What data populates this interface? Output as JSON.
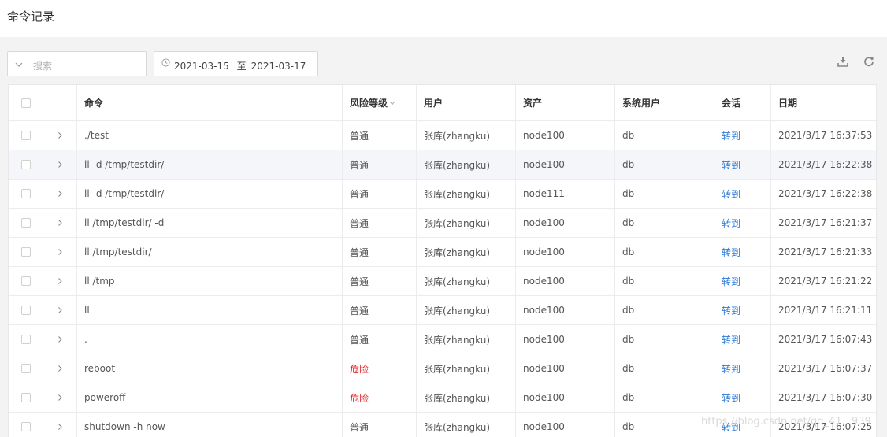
{
  "page": {
    "title": "命令记录"
  },
  "toolbar": {
    "search_placeholder": "搜索",
    "date_start": "2021-03-15",
    "date_sep": "至",
    "date_end": "2021-03-17"
  },
  "table": {
    "columns": [
      "命令",
      "风险等级",
      "用户",
      "资产",
      "系统用户",
      "会话",
      "日期"
    ],
    "rows": [
      {
        "command": "./test",
        "risk": "普通",
        "risk_level": "normal",
        "user": "张库(zhangku)",
        "asset": "node100",
        "sys_user": "db",
        "session": "转到",
        "date": "2021/3/17 16:37:53"
      },
      {
        "command": "ll -d /tmp/testdir/",
        "risk": "普通",
        "risk_level": "normal",
        "user": "张库(zhangku)",
        "asset": "node100",
        "sys_user": "db",
        "session": "转到",
        "date": "2021/3/17 16:22:38"
      },
      {
        "command": "ll -d /tmp/testdir/",
        "risk": "普通",
        "risk_level": "normal",
        "user": "张库(zhangku)",
        "asset": "node111",
        "sys_user": "db",
        "session": "转到",
        "date": "2021/3/17 16:22:38"
      },
      {
        "command": "ll /tmp/testdir/ -d",
        "risk": "普通",
        "risk_level": "normal",
        "user": "张库(zhangku)",
        "asset": "node100",
        "sys_user": "db",
        "session": "转到",
        "date": "2021/3/17 16:21:37"
      },
      {
        "command": "ll /tmp/testdir/",
        "risk": "普通",
        "risk_level": "normal",
        "user": "张库(zhangku)",
        "asset": "node100",
        "sys_user": "db",
        "session": "转到",
        "date": "2021/3/17 16:21:33"
      },
      {
        "command": "ll /tmp",
        "risk": "普通",
        "risk_level": "normal",
        "user": "张库(zhangku)",
        "asset": "node100",
        "sys_user": "db",
        "session": "转到",
        "date": "2021/3/17 16:21:22"
      },
      {
        "command": "ll",
        "risk": "普通",
        "risk_level": "normal",
        "user": "张库(zhangku)",
        "asset": "node100",
        "sys_user": "db",
        "session": "转到",
        "date": "2021/3/17 16:21:11"
      },
      {
        "command": ".",
        "risk": "普通",
        "risk_level": "normal",
        "user": "张库(zhangku)",
        "asset": "node100",
        "sys_user": "db",
        "session": "转到",
        "date": "2021/3/17 16:07:43"
      },
      {
        "command": "reboot",
        "risk": "危险",
        "risk_level": "danger",
        "user": "张库(zhangku)",
        "asset": "node100",
        "sys_user": "db",
        "session": "转到",
        "date": "2021/3/17 16:07:37"
      },
      {
        "command": "poweroff",
        "risk": "危险",
        "risk_level": "danger",
        "user": "张库(zhangku)",
        "asset": "node100",
        "sys_user": "db",
        "session": "转到",
        "date": "2021/3/17 16:07:30"
      },
      {
        "command": "shutdown -h now",
        "risk": "普通",
        "risk_level": "normal",
        "user": "张库(zhangku)",
        "asset": "node100",
        "sys_user": "db",
        "session": "转到",
        "date": "2021/3/17 16:07:25"
      }
    ]
  },
  "watermark": "https://blog.csdn.net/qq_41...939",
  "colors": {
    "danger": "#e0242a",
    "link": "#2f7bd6",
    "highlight_row": "#f4f6fa"
  },
  "icons": {
    "search_dropdown": "chevron-down-icon",
    "date": "clock-icon",
    "download": "download-icon",
    "refresh": "refresh-icon",
    "row_expand": "chevron-right-icon",
    "sort": "sort-caret-icon"
  }
}
